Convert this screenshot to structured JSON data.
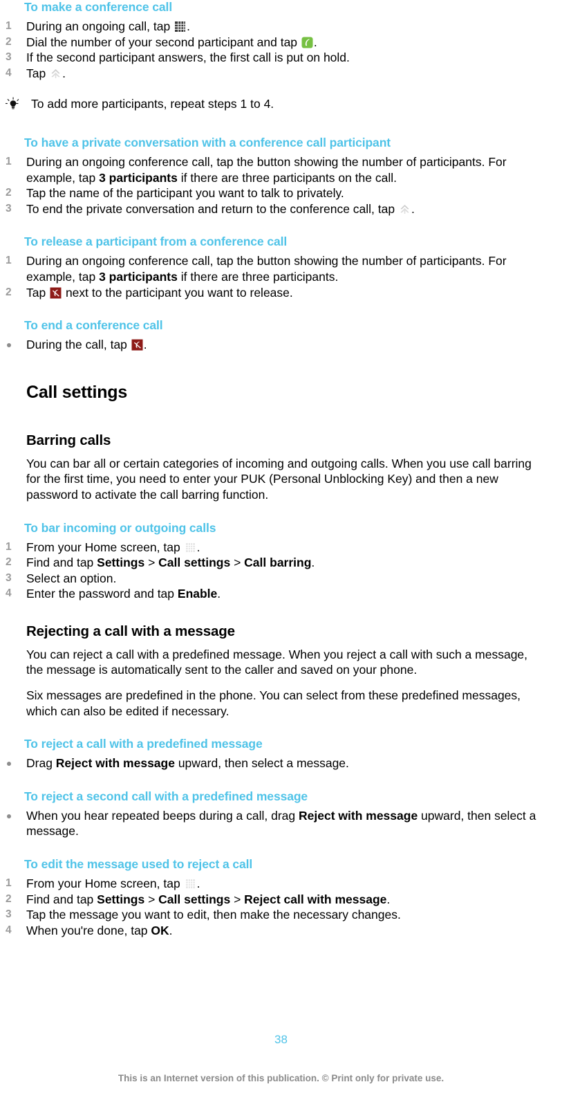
{
  "document": {
    "page_number": "38",
    "footer_note": "This is an Internet version of this publication. © Print only for private use.",
    "accent_color": "#4FC3E8",
    "number_color": "#9a9a9a"
  },
  "sections": {
    "make_conference_call": {
      "heading": "To make a conference call",
      "steps": [
        {
          "num": "1",
          "pre": "During an ongoing call, tap ",
          "icon": "keypad-icon",
          "post": "."
        },
        {
          "num": "2",
          "pre": "Dial the number of your second participant and tap ",
          "icon": "call-green-icon",
          "post": "."
        },
        {
          "num": "3",
          "pre": "If the second participant answers, the first call is put on hold.",
          "icon": "",
          "post": ""
        },
        {
          "num": "4",
          "pre": "Tap ",
          "icon": "merge-call-icon",
          "post": "."
        }
      ],
      "tip": {
        "icon": "lightbulb-icon",
        "text": "To add more participants, repeat steps 1 to 4."
      }
    },
    "private_conversation": {
      "heading": "To have a private conversation with a conference call participant",
      "steps": [
        {
          "num": "1",
          "pre": "During an ongoing conference call, tap the button showing the number of participants. For example, tap ",
          "bold": "3 participants",
          "post": " if there are three participants on the call."
        },
        {
          "num": "2",
          "pre": "Tap the name of the participant you want to talk to privately.",
          "bold": "",
          "post": ""
        },
        {
          "num": "3",
          "pre": "To end the private conversation and return to the conference call, tap ",
          "icon": "merge-call-icon",
          "post": "."
        }
      ]
    },
    "release_participant": {
      "heading": "To release a participant from a conference call",
      "steps": [
        {
          "num": "1",
          "pre": "During an ongoing conference call, tap the button showing the number of participants. For example, tap ",
          "bold": "3 participants",
          "post": " if there are three participants."
        },
        {
          "num": "2",
          "pre": "Tap ",
          "icon": "end-call-red-icon",
          "post": " next to the participant you want to release."
        }
      ]
    },
    "end_conference_call": {
      "heading": "To end a conference call",
      "bullets": [
        {
          "pre": "During the call, tap ",
          "icon": "end-call-red-icon",
          "post": "."
        }
      ]
    },
    "call_settings": {
      "title": "Call settings"
    },
    "barring_calls": {
      "title": "Barring calls",
      "paragraph": "You can bar all or certain categories of incoming and outgoing calls. When you use call barring for the first time, you need to enter your PUK (Personal Unblocking Key) and then a new password to activate the call barring function.",
      "procedure": {
        "heading": "To bar incoming or outgoing calls",
        "steps": [
          {
            "num": "1",
            "pre": "From your Home screen, tap ",
            "icon": "app-drawer-icon",
            "post": "."
          },
          {
            "num": "2",
            "pre": "Find and tap ",
            "b1": "Settings",
            "mid1": " > ",
            "b2": "Call settings",
            "mid2": " > ",
            "b3": "Call barring",
            "post": "."
          },
          {
            "num": "3",
            "pre": "Select an option.",
            "post": ""
          },
          {
            "num": "4",
            "pre": "Enter the password and tap ",
            "b1": "Enable",
            "post": "."
          }
        ]
      }
    },
    "rejecting_with_message": {
      "title": "Rejecting a call with a message",
      "paragraph1": "You can reject a call with a predefined message. When you reject a call with such a message, the message is automatically sent to the caller and saved on your phone.",
      "paragraph2": "Six messages are predefined in the phone. You can select from these predefined messages, which can also be edited if necessary.",
      "reject_predefined": {
        "heading": "To reject a call with a predefined message",
        "bullets": [
          {
            "pre": "Drag ",
            "bold": "Reject with message",
            "post": " upward, then select a message."
          }
        ]
      },
      "reject_second": {
        "heading": "To reject a second call with a predefined message",
        "bullets": [
          {
            "pre": "When you hear repeated beeps during a call, drag ",
            "bold": "Reject with message",
            "post": " upward, then select a message."
          }
        ]
      },
      "edit_message": {
        "heading": "To edit the message used to reject a call",
        "steps": [
          {
            "num": "1",
            "pre": "From your Home screen, tap ",
            "icon": "app-drawer-icon",
            "post": "."
          },
          {
            "num": "2",
            "pre": "Find and tap ",
            "b1": "Settings",
            "mid1": " > ",
            "b2": "Call settings",
            "mid2": " > ",
            "b3": "Reject call with message",
            "post": "."
          },
          {
            "num": "3",
            "pre": "Tap the message you want to edit, then make the necessary changes.",
            "post": ""
          },
          {
            "num": "4",
            "pre": "When you're done, tap ",
            "b1": "OK",
            "post": "."
          }
        ]
      }
    }
  }
}
